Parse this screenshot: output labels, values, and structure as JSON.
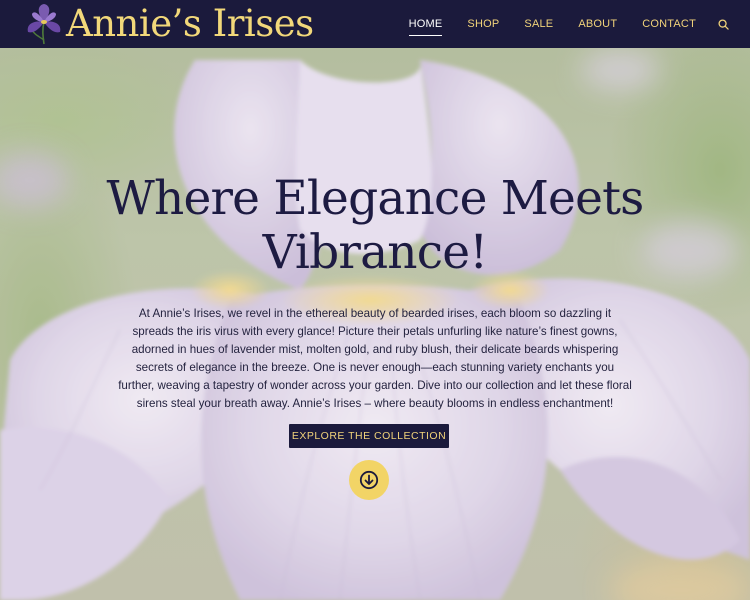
{
  "brand": {
    "name": "Annie’s Irises",
    "logo_icon": "iris-flower-icon"
  },
  "nav": {
    "items": [
      {
        "label": "HOME",
        "active": true
      },
      {
        "label": "SHOP",
        "active": false
      },
      {
        "label": "SALE",
        "active": false
      },
      {
        "label": "ABOUT",
        "active": false
      },
      {
        "label": "CONTACT",
        "active": false
      }
    ],
    "search_icon": "search-icon"
  },
  "hero": {
    "title_line1": "Where Elegance Meets",
    "title_line2": "Vibrance!",
    "body": "At Annie’s Irises, we revel in the ethereal beauty of bearded irises, each bloom so dazzling it spreads the iris virus with every glance! Picture their petals unfurling like nature’s finest gowns, adorned in hues of lavender mist, molten gold, and ruby blush, their delicate beards whispering secrets of elegance in the breeze. One is never enough—each stunning variety enchants you further, weaving a tapestry of wonder across your garden. Dive into our collection and let these floral sirens steal your breath away. Annie’s Irises – where beauty blooms in endless enchantment!",
    "cta_label": "EXPLORE THE COLLECTION",
    "scroll_icon": "arrow-down-circle-icon"
  },
  "colors": {
    "header_bg": "#1b1a3c",
    "accent_gold": "#f0d27a",
    "title_navy": "#1d1b42",
    "scroll_button": "#f2d466"
  }
}
